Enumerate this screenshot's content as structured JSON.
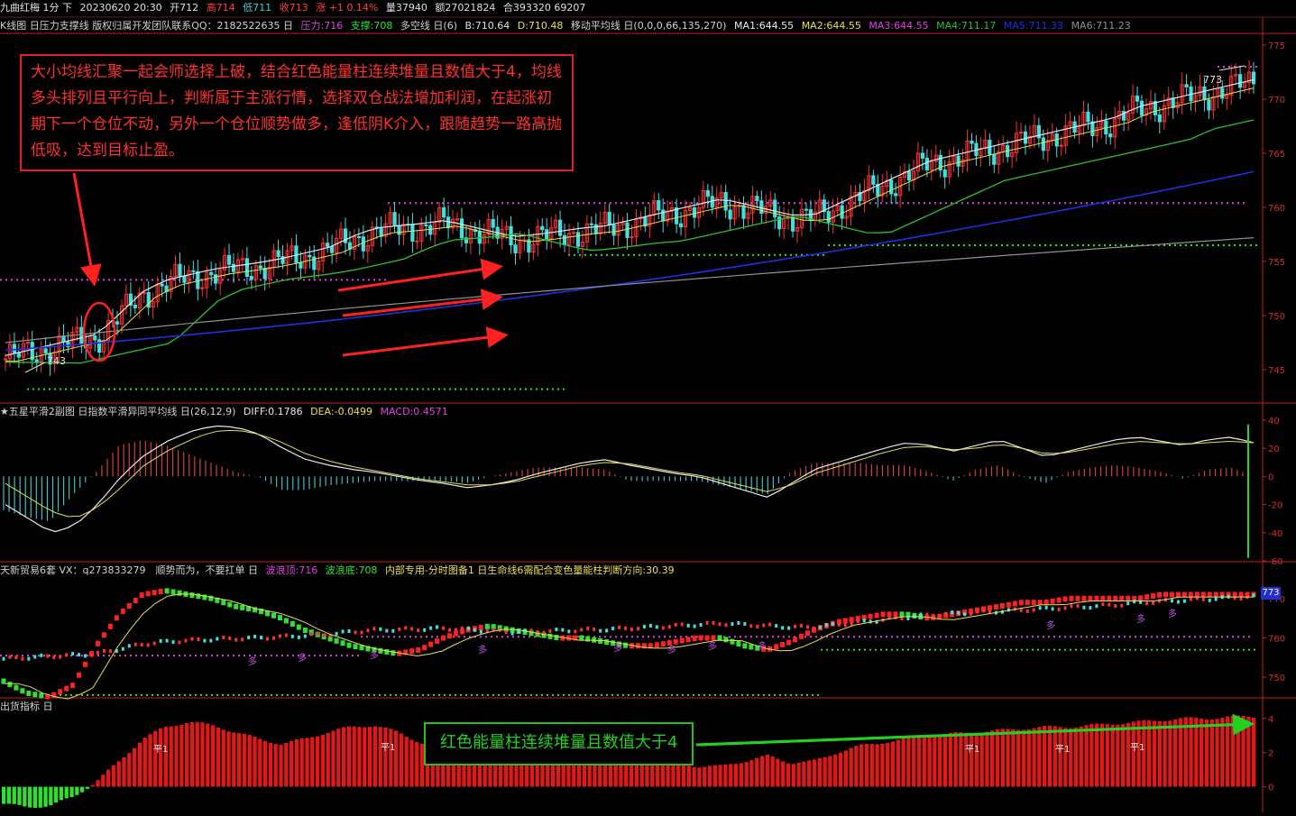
{
  "title_bar": {
    "symbol": "九曲红梅 1分 下",
    "datetime": "20230620 20:30",
    "open": "开712",
    "high": "高714",
    "low": "低711",
    "close": "收713",
    "change": "涨 +1 0.14%",
    "volume": "量37940",
    "amount": "额27021824",
    "position": "合393320 69207"
  },
  "main_header": {
    "label": "K线图 日压力支撑线 版权归属开发团队联系QQ：2182522635 日",
    "pressure": "压力:716",
    "support": "支撑:708",
    "trend": "多空线 日(6)",
    "b": "B:710.64",
    "d": "D:710.48",
    "ma_label": "移动平均线 日(0,0,0,66,135,270)",
    "ma1": "MA1:644.55",
    "ma2": "MA2:644.55",
    "ma3": "MA3:644.55",
    "ma4": "MA4:711.17",
    "ma5": "MA5:711.33",
    "ma6": "MA6:711.23"
  },
  "macd_header": {
    "label": "★五星平滑2副图 日指数平滑异同平均线 日(26,12,9)",
    "diff": "DIFF:0.1786",
    "dea": "DEA:-0.0499",
    "macd": "MACD:0.4571"
  },
  "wave_header": {
    "label": "天新贸易6套 VX：q273833279　顺势而为，不要扛单 日",
    "top": "波浪顶:716",
    "bottom": "波浪底:708",
    "rest": "内部专用-分时图备1 日生命线6需配合变色量能柱判断方向:30.39"
  },
  "energy_header": {
    "label": "出货指标 日"
  },
  "annotation_main": "大小均线汇聚一起会师选择上破，结合红色能量柱连续堆量且数值大于4，均线多头排列且平行向上，判断属于主涨行情，选择双仓战法增加利润，在起涨初期下一个仓位不动，另外一个仓位顺势做多，逢低阴K介入，跟随趋势一路高抛低吸，达到目标止盈。",
  "annotation_energy": "红色能量柱连续堆量且数值大于4",
  "price_labels": {
    "low": "743",
    "high": "773"
  },
  "wave_tag": "773",
  "markers": {
    "duo": "多",
    "ping": "平1"
  },
  "colors": {
    "up": "#ff3030",
    "down": "#40e0e0",
    "ma_white": "#e8e8e8",
    "ma_yellow": "#e8e050",
    "ma_green": "#30c030",
    "ma_blue": "#2030e0",
    "ma_gray": "#909090",
    "pressure": "#e040e0",
    "support": "#30e030",
    "axis": "#c02020"
  },
  "chart_data": [
    {
      "type": "candlestick",
      "name": "K线图",
      "y_ticks": [
        745,
        750,
        755,
        760,
        765,
        770,
        775
      ],
      "ylim": [
        742,
        776
      ],
      "levels": {
        "pressure_1": 753.3,
        "pressure_2": 760.4,
        "pressure_3": 773,
        "support_1": 743.2,
        "support_2": 755.6,
        "support_3": 756.5
      },
      "close_path": [
        746,
        746.5,
        747,
        747.5,
        748,
        750,
        752,
        753,
        753.5,
        754,
        754.3,
        754.6,
        755,
        755.5,
        756,
        757,
        757.8,
        758,
        758.2,
        758.5,
        758,
        757.5,
        757,
        757.2,
        757.5,
        757.8,
        758,
        758.5,
        759,
        759.5,
        760,
        760.5,
        760,
        759.5,
        759,
        759,
        760,
        761,
        762,
        763,
        764,
        764.5,
        765,
        765.5,
        766,
        766.5,
        767,
        767.5,
        768,
        769,
        769.5,
        770,
        770.5,
        771,
        771.5
      ]
    },
    {
      "type": "line+bar",
      "name": "MACD",
      "y_ticks": [
        40,
        20,
        0,
        -20,
        -40,
        -60
      ],
      "ylim": [
        -60,
        40
      ],
      "diff": [
        -20,
        -30,
        -40,
        -35,
        -20,
        0,
        15,
        25,
        32,
        36,
        35,
        30,
        20,
        12,
        8,
        5,
        3,
        0,
        -3,
        -5,
        -8,
        -6,
        -3,
        2,
        6,
        10,
        12,
        8,
        5,
        2,
        0,
        -5,
        -10,
        -15,
        -5,
        5,
        10,
        15,
        20,
        24,
        22,
        18,
        22,
        26,
        20,
        14,
        18,
        22,
        26,
        28,
        25,
        22,
        26,
        28,
        24
      ],
      "dea": [
        -5,
        -15,
        -25,
        -30,
        -22,
        -8,
        8,
        18,
        26,
        32,
        33,
        30,
        24,
        16,
        11,
        7,
        4,
        1,
        -2,
        -4,
        -6,
        -6,
        -4,
        0,
        4,
        8,
        10,
        9,
        6,
        3,
        1,
        -3,
        -7,
        -11,
        -6,
        2,
        7,
        12,
        17,
        21,
        21,
        19,
        20,
        23,
        20,
        16,
        17,
        20,
        23,
        25,
        24,
        23,
        24,
        25,
        24
      ],
      "hist": [
        -15,
        -18,
        -20,
        -8,
        2,
        14,
        16,
        14,
        10,
        6,
        2,
        0,
        -6,
        -6,
        -4,
        -3,
        -2,
        -2,
        -2,
        -2,
        -3,
        0,
        2,
        4,
        4,
        4,
        3,
        -2,
        -2,
        -2,
        -2,
        -4,
        -6,
        -8,
        2,
        6,
        6,
        6,
        5,
        5,
        2,
        -2,
        3,
        5,
        0,
        -3,
        2,
        4,
        5,
        4,
        2,
        -1,
        3,
        4,
        0
      ]
    },
    {
      "type": "line+dot",
      "name": "波浪",
      "y_ticks": [
        750,
        760,
        770
      ],
      "ylim": [
        745,
        775
      ],
      "trend": [
        749,
        746,
        745,
        748,
        758,
        766,
        771,
        772,
        771,
        770,
        768,
        767,
        765,
        762,
        760,
        758,
        757,
        756,
        757,
        760,
        762,
        763,
        762,
        761,
        760,
        760,
        759,
        758,
        758,
        759,
        760,
        760,
        758,
        757,
        759,
        762,
        764,
        765,
        766,
        766,
        765,
        766,
        767,
        768,
        769,
        769,
        770,
        770,
        770,
        770,
        771,
        771,
        771,
        771,
        771
      ]
    },
    {
      "type": "bar",
      "name": "出货指标",
      "y_ticks": [
        4,
        2,
        0
      ],
      "ylim": [
        -1.5,
        4.2
      ],
      "values": [
        -1,
        -1.2,
        -1.1,
        -0.6,
        0.3,
        1.5,
        2.8,
        3.5,
        3.8,
        3.6,
        3.2,
        2.8,
        2.5,
        2.8,
        3.2,
        3.5,
        3.6,
        3.2,
        2.6,
        2,
        1.6,
        1.5,
        1.6,
        2,
        2.2,
        2.4,
        2.6,
        2.4,
        1.8,
        1.4,
        1.2,
        1.2,
        1.5,
        1.8,
        1.4,
        1.5,
        2,
        2.4,
        2.6,
        2.8,
        3,
        3.1,
        3.2,
        3.3,
        3.4,
        3.5,
        3.5,
        3.6,
        3.7,
        3.8,
        3.9,
        4,
        4,
        4.1,
        4.1
      ]
    }
  ]
}
